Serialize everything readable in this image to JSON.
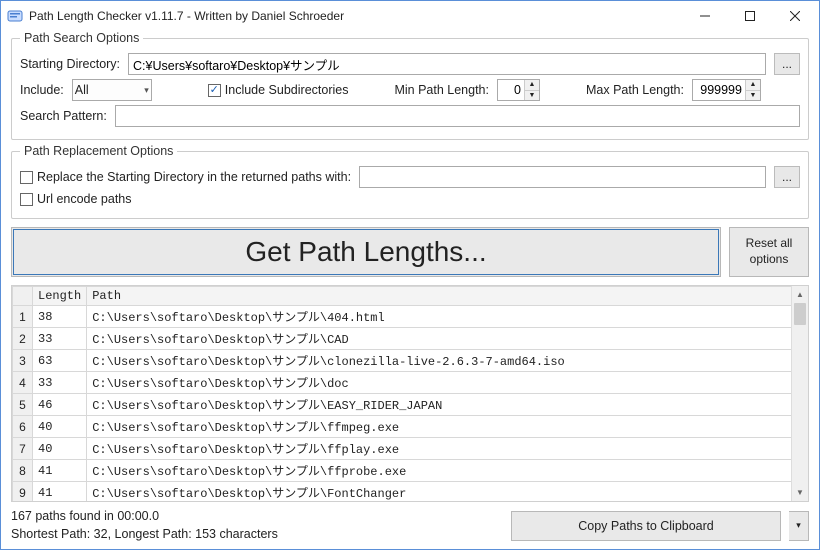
{
  "window": {
    "title": "Path Length Checker v1.11.7 - Written by Daniel Schroeder"
  },
  "search": {
    "legend": "Path Search Options",
    "starting_dir_label": "Starting Directory:",
    "starting_dir_value": "C:¥Users¥softaro¥Desktop¥サンプル",
    "browse_ellipsis": "...",
    "include_label": "Include:",
    "include_value": "All",
    "include_subdirs_label": "Include Subdirectories",
    "min_label": "Min Path Length:",
    "min_value": "0",
    "max_label": "Max Path Length:",
    "max_value": "999999",
    "search_pattern_label": "Search Pattern:",
    "search_pattern_value": ""
  },
  "replacement": {
    "legend": "Path Replacement Options",
    "replace_label": "Replace the Starting Directory in the returned paths with:",
    "replace_value": "",
    "browse_ellipsis": "...",
    "urlencode_label": "Url encode paths"
  },
  "actions": {
    "get_label": "Get Path Lengths...",
    "reset_label": "Reset all options"
  },
  "table": {
    "col_length": "Length",
    "col_path": "Path",
    "rows": [
      {
        "n": "1",
        "length": "38",
        "path": "C:\\Users\\softaro\\Desktop\\サンプル\\404.html"
      },
      {
        "n": "2",
        "length": "33",
        "path": "C:\\Users\\softaro\\Desktop\\サンプル\\CAD"
      },
      {
        "n": "3",
        "length": "63",
        "path": "C:\\Users\\softaro\\Desktop\\サンプル\\clonezilla-live-2.6.3-7-amd64.iso"
      },
      {
        "n": "4",
        "length": "33",
        "path": "C:\\Users\\softaro\\Desktop\\サンプル\\doc"
      },
      {
        "n": "5",
        "length": "46",
        "path": "C:\\Users\\softaro\\Desktop\\サンプル\\EASY_RIDER_JAPAN"
      },
      {
        "n": "6",
        "length": "40",
        "path": "C:\\Users\\softaro\\Desktop\\サンプル\\ffmpeg.exe"
      },
      {
        "n": "7",
        "length": "40",
        "path": "C:\\Users\\softaro\\Desktop\\サンプル\\ffplay.exe"
      },
      {
        "n": "8",
        "length": "41",
        "path": "C:\\Users\\softaro\\Desktop\\サンプル\\ffprobe.exe"
      },
      {
        "n": "9",
        "length": "41",
        "path": "C:\\Users\\softaro\\Desktop\\サンプル\\FontChanger"
      }
    ]
  },
  "status": {
    "line1": "167 paths found in 00:00.0",
    "line2": "Shortest Path: 32, Longest Path: 153 characters",
    "copy_label": "Copy Paths to Clipboard"
  }
}
